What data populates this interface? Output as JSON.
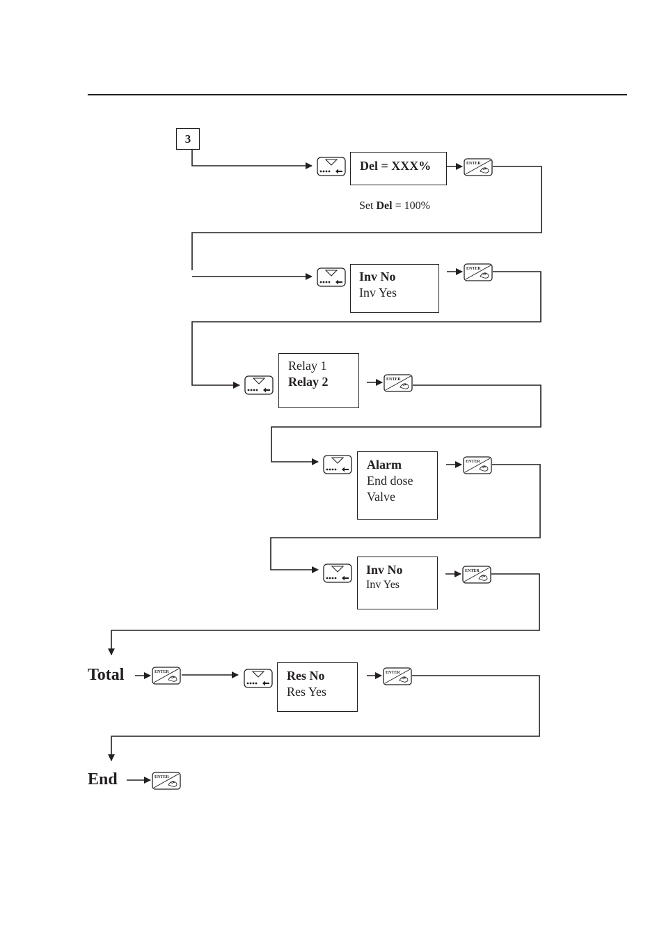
{
  "step_marker": "3",
  "icons": {
    "nav_key": "scroll-arrow-key-icon",
    "enter_key": "enter-key-icon",
    "arrow": "arrow-right-icon"
  },
  "steps": [
    {
      "id": "del",
      "lines": [
        {
          "text": "Del = XXX%",
          "bold": true
        }
      ],
      "note": {
        "prefix": "Set ",
        "bold": "Del",
        "suffix": " = 100%"
      }
    },
    {
      "id": "inv1",
      "lines": [
        {
          "text": "Inv No",
          "bold": true
        },
        {
          "text": "Inv Yes",
          "bold": false
        }
      ]
    },
    {
      "id": "relay",
      "lines": [
        {
          "text": "Relay 1",
          "bold": false
        },
        {
          "text": "Relay 2",
          "bold": true
        }
      ]
    },
    {
      "id": "alarm",
      "lines": [
        {
          "text": "Alarm",
          "bold": true
        },
        {
          "text": "End dose",
          "bold": false
        },
        {
          "text": "Valve",
          "bold": false
        }
      ]
    },
    {
      "id": "inv2",
      "lines": [
        {
          "text": "Inv No",
          "bold": true
        },
        {
          "text": "Inv Yes",
          "bold": false
        }
      ]
    },
    {
      "id": "res",
      "lines": [
        {
          "text": "Res No",
          "bold": true
        },
        {
          "text": "Res Yes",
          "bold": false
        }
      ]
    }
  ],
  "labels": {
    "total": "Total",
    "end": "End"
  },
  "enter_key_text": "ENTER"
}
